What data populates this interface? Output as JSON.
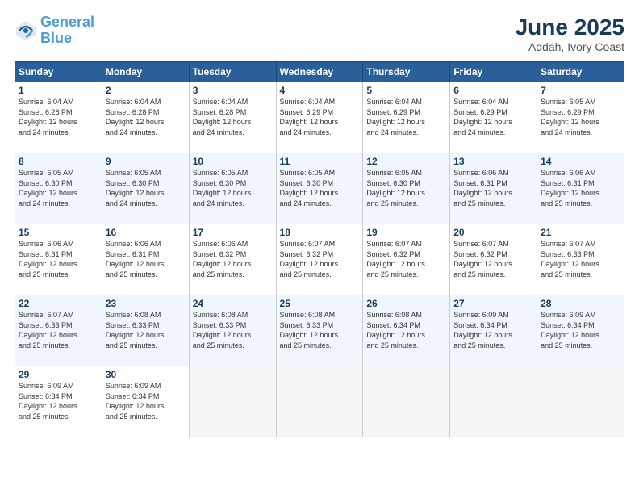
{
  "header": {
    "logo_line1": "General",
    "logo_line2": "Blue",
    "month_year": "June 2025",
    "location": "Addah, Ivory Coast"
  },
  "days_of_week": [
    "Sunday",
    "Monday",
    "Tuesday",
    "Wednesday",
    "Thursday",
    "Friday",
    "Saturday"
  ],
  "weeks": [
    [
      {
        "day": "1",
        "info": "Sunrise: 6:04 AM\nSunset: 6:28 PM\nDaylight: 12 hours\nand 24 minutes."
      },
      {
        "day": "2",
        "info": "Sunrise: 6:04 AM\nSunset: 6:28 PM\nDaylight: 12 hours\nand 24 minutes."
      },
      {
        "day": "3",
        "info": "Sunrise: 6:04 AM\nSunset: 6:28 PM\nDaylight: 12 hours\nand 24 minutes."
      },
      {
        "day": "4",
        "info": "Sunrise: 6:04 AM\nSunset: 6:29 PM\nDaylight: 12 hours\nand 24 minutes."
      },
      {
        "day": "5",
        "info": "Sunrise: 6:04 AM\nSunset: 6:29 PM\nDaylight: 12 hours\nand 24 minutes."
      },
      {
        "day": "6",
        "info": "Sunrise: 6:04 AM\nSunset: 6:29 PM\nDaylight: 12 hours\nand 24 minutes."
      },
      {
        "day": "7",
        "info": "Sunrise: 6:05 AM\nSunset: 6:29 PM\nDaylight: 12 hours\nand 24 minutes."
      }
    ],
    [
      {
        "day": "8",
        "info": "Sunrise: 6:05 AM\nSunset: 6:30 PM\nDaylight: 12 hours\nand 24 minutes."
      },
      {
        "day": "9",
        "info": "Sunrise: 6:05 AM\nSunset: 6:30 PM\nDaylight: 12 hours\nand 24 minutes."
      },
      {
        "day": "10",
        "info": "Sunrise: 6:05 AM\nSunset: 6:30 PM\nDaylight: 12 hours\nand 24 minutes."
      },
      {
        "day": "11",
        "info": "Sunrise: 6:05 AM\nSunset: 6:30 PM\nDaylight: 12 hours\nand 24 minutes."
      },
      {
        "day": "12",
        "info": "Sunrise: 6:05 AM\nSunset: 6:30 PM\nDaylight: 12 hours\nand 25 minutes."
      },
      {
        "day": "13",
        "info": "Sunrise: 6:06 AM\nSunset: 6:31 PM\nDaylight: 12 hours\nand 25 minutes."
      },
      {
        "day": "14",
        "info": "Sunrise: 6:06 AM\nSunset: 6:31 PM\nDaylight: 12 hours\nand 25 minutes."
      }
    ],
    [
      {
        "day": "15",
        "info": "Sunrise: 6:06 AM\nSunset: 6:31 PM\nDaylight: 12 hours\nand 25 minutes."
      },
      {
        "day": "16",
        "info": "Sunrise: 6:06 AM\nSunset: 6:31 PM\nDaylight: 12 hours\nand 25 minutes."
      },
      {
        "day": "17",
        "info": "Sunrise: 6:06 AM\nSunset: 6:32 PM\nDaylight: 12 hours\nand 25 minutes."
      },
      {
        "day": "18",
        "info": "Sunrise: 6:07 AM\nSunset: 6:32 PM\nDaylight: 12 hours\nand 25 minutes."
      },
      {
        "day": "19",
        "info": "Sunrise: 6:07 AM\nSunset: 6:32 PM\nDaylight: 12 hours\nand 25 minutes."
      },
      {
        "day": "20",
        "info": "Sunrise: 6:07 AM\nSunset: 6:32 PM\nDaylight: 12 hours\nand 25 minutes."
      },
      {
        "day": "21",
        "info": "Sunrise: 6:07 AM\nSunset: 6:33 PM\nDaylight: 12 hours\nand 25 minutes."
      }
    ],
    [
      {
        "day": "22",
        "info": "Sunrise: 6:07 AM\nSunset: 6:33 PM\nDaylight: 12 hours\nand 25 minutes."
      },
      {
        "day": "23",
        "info": "Sunrise: 6:08 AM\nSunset: 6:33 PM\nDaylight: 12 hours\nand 25 minutes."
      },
      {
        "day": "24",
        "info": "Sunrise: 6:08 AM\nSunset: 6:33 PM\nDaylight: 12 hours\nand 25 minutes."
      },
      {
        "day": "25",
        "info": "Sunrise: 6:08 AM\nSunset: 6:33 PM\nDaylight: 12 hours\nand 25 minutes."
      },
      {
        "day": "26",
        "info": "Sunrise: 6:08 AM\nSunset: 6:34 PM\nDaylight: 12 hours\nand 25 minutes."
      },
      {
        "day": "27",
        "info": "Sunrise: 6:09 AM\nSunset: 6:34 PM\nDaylight: 12 hours\nand 25 minutes."
      },
      {
        "day": "28",
        "info": "Sunrise: 6:09 AM\nSunset: 6:34 PM\nDaylight: 12 hours\nand 25 minutes."
      }
    ],
    [
      {
        "day": "29",
        "info": "Sunrise: 6:09 AM\nSunset: 6:34 PM\nDaylight: 12 hours\nand 25 minutes."
      },
      {
        "day": "30",
        "info": "Sunrise: 6:09 AM\nSunset: 6:34 PM\nDaylight: 12 hours\nand 25 minutes."
      },
      {
        "day": "",
        "info": ""
      },
      {
        "day": "",
        "info": ""
      },
      {
        "day": "",
        "info": ""
      },
      {
        "day": "",
        "info": ""
      },
      {
        "day": "",
        "info": ""
      }
    ]
  ]
}
